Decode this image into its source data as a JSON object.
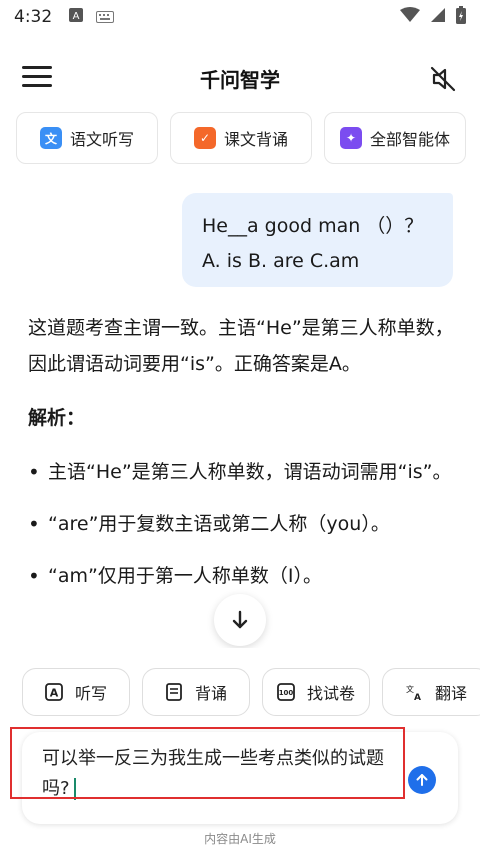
{
  "status_bar": {
    "time": "4:32"
  },
  "header": {
    "title": "千问智学"
  },
  "quick_actions": [
    {
      "label": "语文听写",
      "icon": "chinese-dictation-icon",
      "color": "#3a8ff5",
      "glyph": "文"
    },
    {
      "label": "课文背诵",
      "icon": "recite-icon",
      "color": "#f4682a",
      "glyph": "✓"
    },
    {
      "label": "全部智能体",
      "icon": "ai-agents-icon",
      "color": "#7b4cf0",
      "glyph": "✦"
    }
  ],
  "user_message": {
    "line1": "He__a good man （）？",
    "line2": "A. is B. are C.am"
  },
  "answer": {
    "intro": "这道题考查主谓一致。主语“He”是第三人称单数，因此谓语动词要用“is”。正确答案是A。",
    "analysis_title": "解析：",
    "bullets": [
      "主语“He”是第三人称单数，谓语动词需用“is”。",
      "“are”用于复数主语或第二人称（you）。",
      "“am”仅用于第一人称单数（I）。"
    ]
  },
  "tools": [
    {
      "label": "听写",
      "icon": "dictation-icon"
    },
    {
      "label": "背诵",
      "icon": "book-icon"
    },
    {
      "label": "找试卷",
      "icon": "exam-paper-icon"
    },
    {
      "label": "翻译",
      "icon": "translate-icon"
    }
  ],
  "input": {
    "value": "可以举一反三为我生成一些考点类似的试题吗?"
  },
  "footer": {
    "note": "内容由AI生成"
  },
  "colors": {
    "accent": "#1f6fea",
    "bubble": "#e8f1fd",
    "highlight": "#e02f2f"
  }
}
